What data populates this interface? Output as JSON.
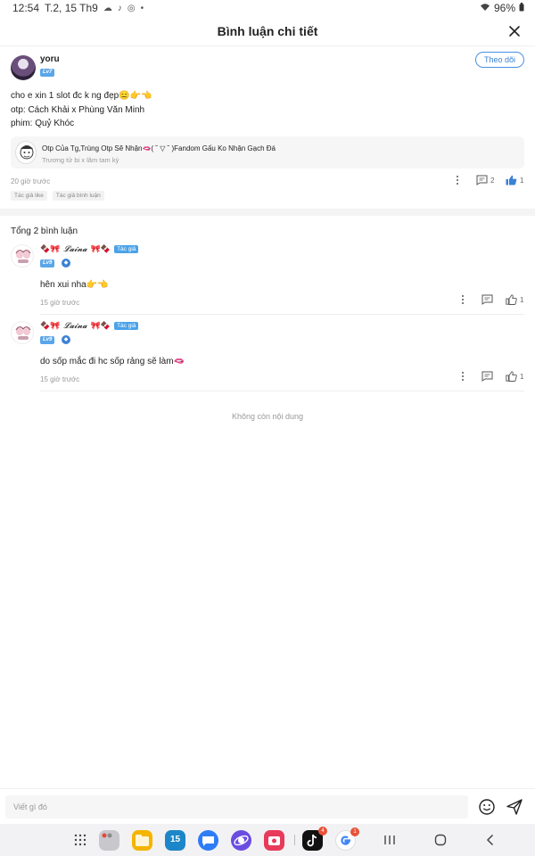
{
  "status_bar": {
    "time": "12:54",
    "date": "T.2, 15 Th9",
    "battery": "96%"
  },
  "header": {
    "title": "Bình luận chi tiết"
  },
  "post": {
    "username": "yoru",
    "level": "Lv7",
    "follow_label": "Theo dõi",
    "content_lines": [
      "cho e xin 1 slot đc k ng đẹp😑👉👈",
      "otp: Cách Khải x Phùng Văn Minh",
      "phim: Quỷ Khóc"
    ],
    "book": {
      "title": "Otp Của Tg,Trùng Otp Sẽ Nhận🫦( ˘ ▽ ˘ )Fandom Gấu Ko Nhận Gạch Đá",
      "subtitle": "Trương tử bi x lâm tam kỳ"
    },
    "time": "20 giờ trước",
    "reply_count": "2",
    "like_count": "1",
    "tags": [
      "Tác giả like",
      "Tác giả bình luận"
    ]
  },
  "comments_section": {
    "total_label": "Tổng 2 bình luận",
    "comments": [
      {
        "name_prefix": "🍫🎀",
        "name_fancy": "𝓛𝓪𝓲𝓷𝓪",
        "name_suffix": "🎀🍫",
        "author_badge": "Tác giả",
        "level": "Lv9",
        "text": "hên xui nha👉👈",
        "time": "15 giờ trước",
        "like_count": "1"
      },
      {
        "name_prefix": "🍫🎀",
        "name_fancy": "𝓛𝓪𝓲𝓷𝓪",
        "name_suffix": "🎀🍫",
        "author_badge": "Tác giả",
        "level": "Lv9",
        "text": "do sốp mắc đi hc sốp rảng sẽ làm🫦",
        "time": "15 giờ trước",
        "like_count": "1"
      }
    ],
    "no_more_label": "Không còn nội dung"
  },
  "input_bar": {
    "placeholder": "Viết gì đó"
  },
  "navbar": {
    "calendar_day": "15",
    "tiktok_badge": "4",
    "google_badge": "1"
  }
}
